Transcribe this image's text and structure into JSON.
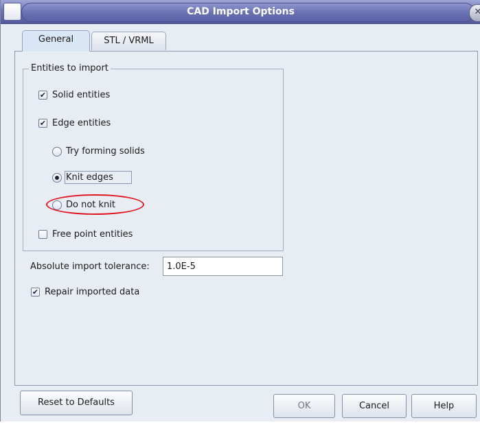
{
  "window": {
    "title": "CAD Import Options"
  },
  "tabs": [
    {
      "label": "General",
      "selected": true
    },
    {
      "label": "STL / VRML",
      "selected": false
    }
  ],
  "entities_group": {
    "label": "Entities to import",
    "solid": {
      "label": "Solid entities",
      "checked": true
    },
    "edge": {
      "label": "Edge entities",
      "checked": true
    },
    "edge_mode": [
      {
        "label": "Try forming solids",
        "selected": false
      },
      {
        "label": "Knit edges",
        "selected": true
      },
      {
        "label": "Do not knit",
        "selected": false
      }
    ],
    "free_point": {
      "label": "Free point entities",
      "checked": false
    }
  },
  "tolerance": {
    "label": "Absolute import tolerance:",
    "value": "1.0E-5"
  },
  "repair": {
    "label": "Repair imported data",
    "checked": true
  },
  "buttons": {
    "reset": "Reset to Defaults",
    "ok": "OK",
    "cancel": "Cancel",
    "help": "Help"
  },
  "icons": {
    "check_glyph": "✔",
    "close_glyph": "✕"
  },
  "colors": {
    "annotation": "#e0141e",
    "titlebar": "#6f76b7"
  }
}
